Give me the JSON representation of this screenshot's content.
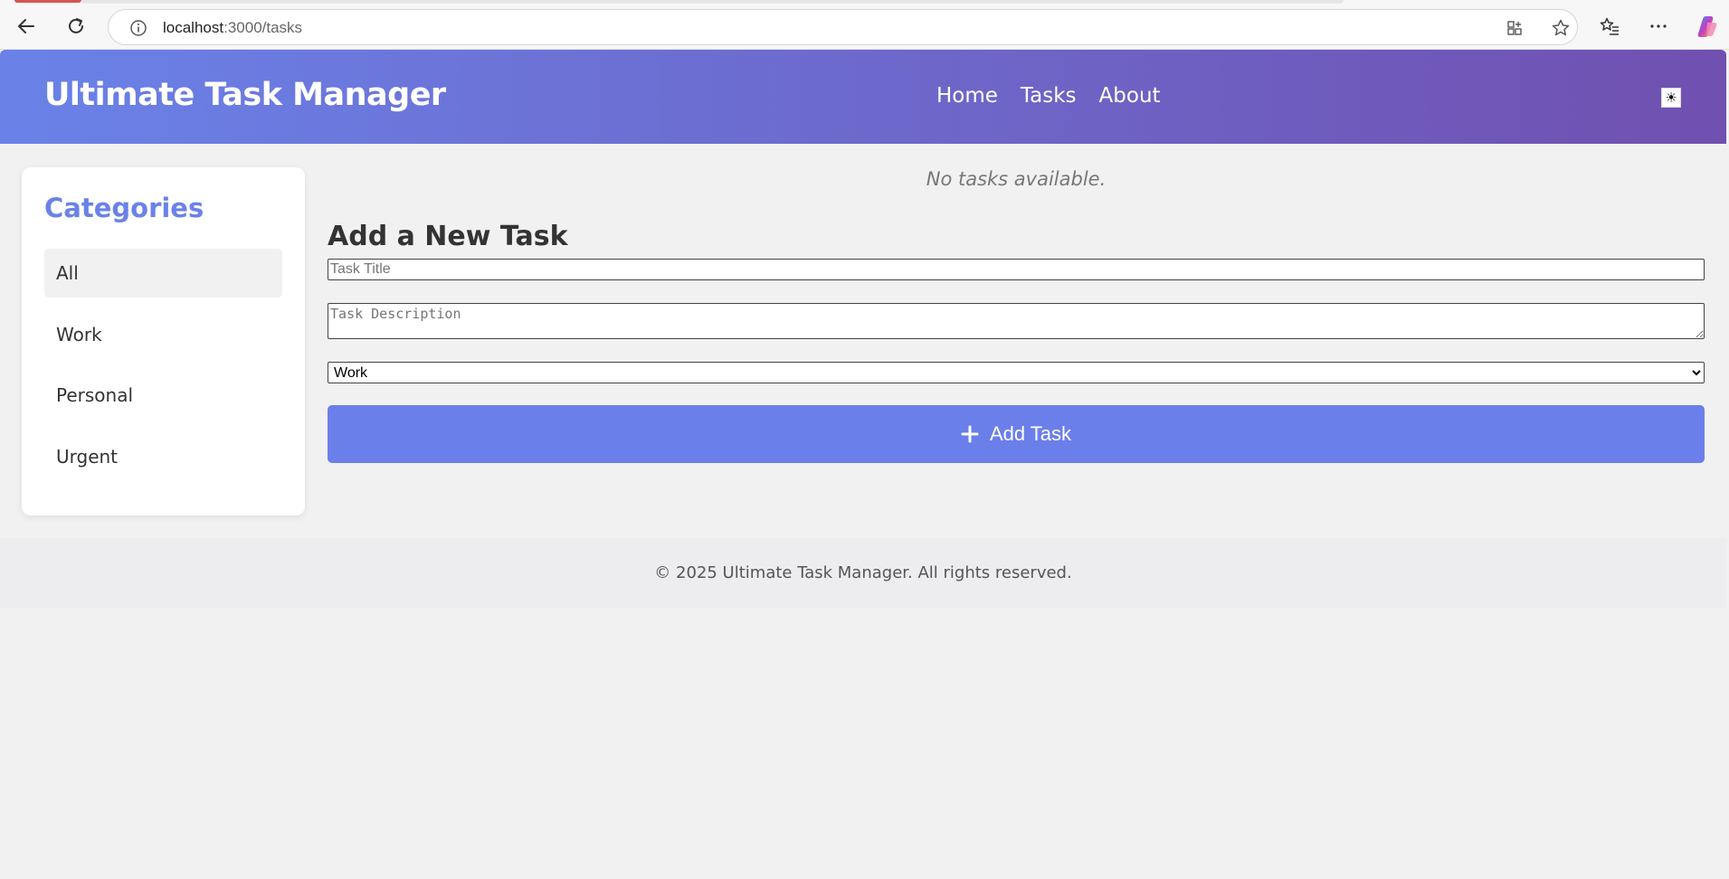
{
  "browser": {
    "url_host": "localhost",
    "url_path": ":3000/tasks"
  },
  "header": {
    "title": "Ultimate Task Manager",
    "nav": [
      "Home",
      "Tasks",
      "About"
    ],
    "theme_icon": "☀"
  },
  "sidebar": {
    "title": "Categories",
    "items": [
      {
        "label": "All",
        "active": true
      },
      {
        "label": "Work",
        "active": false
      },
      {
        "label": "Personal",
        "active": false
      },
      {
        "label": "Urgent",
        "active": false
      }
    ]
  },
  "main": {
    "empty_message": "No tasks available.",
    "form_title": "Add a New Task",
    "title_placeholder": "Task Title",
    "description_placeholder": "Task Description",
    "category_selected": "Work",
    "add_button_label": "Add Task"
  },
  "footer": {
    "text": "© 2025 Ultimate Task Manager. All rights reserved."
  },
  "colors": {
    "accent": "#6a7fea",
    "header_gradient_start": "#6a82e8",
    "header_gradient_end": "#7050b0"
  }
}
